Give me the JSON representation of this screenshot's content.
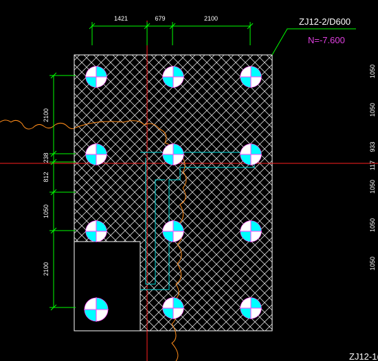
{
  "drawing": {
    "label": "ZJ12-2/D600",
    "elevation": "N=-7.600",
    "corner_label": "ZJ12-1(",
    "colors": {
      "background": "#000000",
      "outline": "#ffffff",
      "hatch": "#d8d8d8",
      "dimension": "#00ff00",
      "axis": "#ff2020",
      "pile_fill": "#00ffff",
      "pile_outline": "#ff40ff",
      "cloud": "#ff8c1a",
      "cyan_line": "#00e0e0",
      "elevation_text": "#e040e0"
    }
  },
  "dimensions": {
    "top": [
      "1421",
      "679",
      "2100"
    ],
    "left": [
      "2100",
      "238",
      "812",
      "1050",
      "2100"
    ],
    "right": [
      "1050",
      "1050",
      "933",
      "117",
      "1050",
      "1050",
      "1050"
    ]
  }
}
